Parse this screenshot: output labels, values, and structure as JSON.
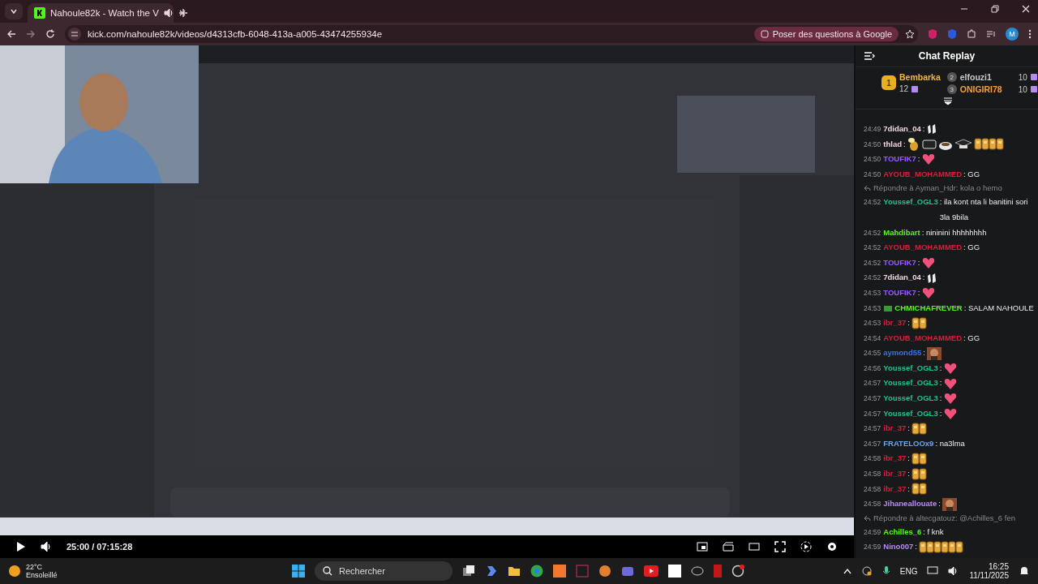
{
  "browser": {
    "tab": {
      "title": "Nahoule82k - Watch the V"
    },
    "url": "kick.com/nahoule82k/videos/d4313cfb-6048-413a-a005-43474255934e",
    "ask_button": "Poser des questions à Google",
    "avatar": "M"
  },
  "video": {
    "kind": "picture",
    "time": "25:00 / 07:15:28"
  },
  "chat": {
    "title": "Chat Replay",
    "leaders": [
      {
        "rank": "1",
        "name": "Bembarka",
        "count": "12",
        "color": "#f5b73a"
      },
      {
        "rank": "2",
        "name": "elfouzi1",
        "count": "10",
        "color": "#c9c9c9"
      },
      {
        "rank": "3",
        "name": "ONIGIRI78",
        "count": "10",
        "color": "#f0a040"
      }
    ],
    "messages": [
      {
        "time": "24:49",
        "user": "7didan_04",
        "color": "#f3d6e6",
        "text": ":",
        "emotes": [
          {
            "kind": "hands"
          }
        ]
      },
      {
        "time": "24:50",
        "user": "thlad",
        "color": "#f3d6e6",
        "text": ":",
        "emotes": [
          {
            "kind": "bee"
          },
          {
            "kind": "tag"
          },
          {
            "kind": "cup"
          },
          {
            "kind": "cap"
          },
          {
            "kind": "gg4"
          }
        ]
      },
      {
        "time": "24:50",
        "user": "TOUFIK7",
        "color": "#9b5cff",
        "text": ":",
        "emotes": [
          {
            "kind": "heart"
          }
        ]
      },
      {
        "time": "24:50",
        "user": "AYOUB_MOHAMMED",
        "color": "#d4203c",
        "text": ": GG"
      },
      {
        "time": "24:52",
        "user": "Youssef_OGL3",
        "color": "#20c08f",
        "text": ": ila kont nta li banitini sori 3la 9bila",
        "reply": "Répondre à Ayman_Hdr: kola o hemo"
      },
      {
        "time": "24:52",
        "user": "Mahdibart",
        "color": "#53fc18",
        "text": ": nininini hhhhhhhh"
      },
      {
        "time": "24:52",
        "user": "AYOUB_MOHAMMED",
        "color": "#d4203c",
        "text": ": GG"
      },
      {
        "time": "24:52",
        "user": "TOUFIK7",
        "color": "#9b5cff",
        "text": ":",
        "emotes": [
          {
            "kind": "heart"
          }
        ]
      },
      {
        "time": "24:52",
        "user": "7didan_04",
        "color": "#f3d6e6",
        "text": ":",
        "emotes": [
          {
            "kind": "hands"
          }
        ]
      },
      {
        "time": "24:53",
        "user": "TOUFIK7",
        "color": "#9b5cff",
        "text": ":",
        "emotes": [
          {
            "kind": "heart"
          }
        ]
      },
      {
        "time": "24:53",
        "user": "CHMICHAFREVER",
        "color": "#53fc18",
        "text": ": SALAM NAHOULE",
        "badge": {
          "kind": "cash"
        }
      },
      {
        "time": "24:53",
        "user": "ibr_37",
        "color": "#d4203c",
        "text": ":",
        "emotes": [
          {
            "kind": "gg2"
          }
        ]
      },
      {
        "time": "24:54",
        "user": "AYOUB_MOHAMMED",
        "color": "#d4203c",
        "text": ": GG"
      },
      {
        "time": "24:55",
        "user": "aymond55",
        "color": "#3d72e0",
        "text": ":",
        "emotes": [
          {
            "kind": "face"
          }
        ]
      },
      {
        "time": "24:56",
        "user": "Youssef_OGL3",
        "color": "#20c08f",
        "text": ":",
        "emotes": [
          {
            "kind": "heart"
          }
        ]
      },
      {
        "time": "24:57",
        "user": "Youssef_OGL3",
        "color": "#20c08f",
        "text": ":",
        "emotes": [
          {
            "kind": "heart"
          }
        ]
      },
      {
        "time": "24:57",
        "user": "Youssef_OGL3",
        "color": "#20c08f",
        "text": ":",
        "emotes": [
          {
            "kind": "heart"
          }
        ]
      },
      {
        "time": "24:57",
        "user": "Youssef_OGL3",
        "color": "#20c08f",
        "text": ":",
        "emotes": [
          {
            "kind": "heart"
          }
        ]
      },
      {
        "time": "24:57",
        "user": "ibr_37",
        "color": "#d4203c",
        "text": ":",
        "emotes": [
          {
            "kind": "gg2"
          }
        ]
      },
      {
        "time": "24:57",
        "user": "FRATELOOx9",
        "color": "#6fa3e8",
        "text": ": na3lma"
      },
      {
        "time": "24:58",
        "user": "ibr_37",
        "color": "#d4203c",
        "text": ":",
        "emotes": [
          {
            "kind": "gg2"
          }
        ]
      },
      {
        "time": "24:58",
        "user": "ibr_37",
        "color": "#d4203c",
        "text": ":",
        "emotes": [
          {
            "kind": "gg2"
          }
        ]
      },
      {
        "time": "24:58",
        "user": "ibr_37",
        "color": "#d4203c",
        "text": ":",
        "emotes": [
          {
            "kind": "gg2"
          }
        ]
      },
      {
        "time": "24:58",
        "user": "Jihaneallouate",
        "color": "#b98cf5",
        "text": ":",
        "emotes": [
          {
            "kind": "face"
          }
        ]
      },
      {
        "time": "24:59",
        "user": "Achilles_6",
        "color": "#53fc18",
        "text": ": f knk",
        "reply": "Répondre à altecgatouz: @Achilles_6 fen"
      },
      {
        "time": "24:59",
        "user": "Nino007",
        "color": "#b98cf5",
        "text": ":",
        "emotes": [
          {
            "kind": "gg6"
          }
        ]
      }
    ]
  },
  "taskbar": {
    "weather": {
      "temp": "22°C",
      "condition": "Ensoleillé"
    },
    "search": {
      "placeholder": "Rechercher"
    },
    "language": "ENG",
    "time": "16:25",
    "date": "11/11/2025"
  }
}
